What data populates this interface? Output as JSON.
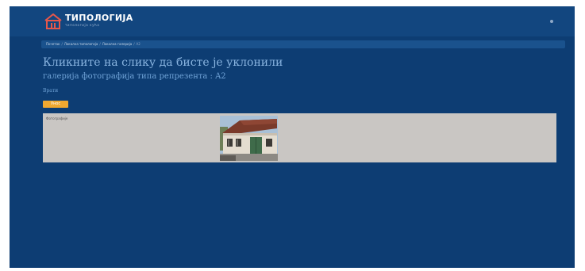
{
  "header": {
    "brand": "ТИПОЛОГИЈА",
    "brand_sub": "типологија кућа",
    "logo_icon": "house-logo-icon",
    "colors": {
      "header_bg": "#12467f",
      "page_bg": "#0d3d73",
      "accent": "#f0a830",
      "logo": "#e8574a"
    }
  },
  "breadcrumb": {
    "items": [
      "Почетак",
      "Локална типологија",
      "Локална галерија",
      "A2"
    ]
  },
  "main": {
    "title": "Кликните на слику да бисте је уклонили",
    "subtitle": "галерија фотографија типа репрезента : A2",
    "back_link": "Врати",
    "action_button": "Унос"
  },
  "gallery": {
    "label": "Фотографије",
    "photo_icon": "house-photo"
  }
}
